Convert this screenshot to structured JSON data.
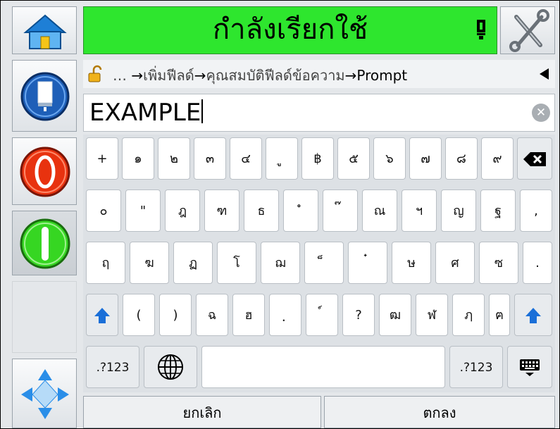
{
  "status": {
    "text": "กำลังเรียกใช้",
    "color": "#2ee62e"
  },
  "breadcrumb": {
    "prefix": "…",
    "items": [
      "เพิ่มฟีลด์",
      "คุณสมบัติฟีลด์ข้อความ",
      "Prompt"
    ],
    "separator": "→"
  },
  "textfield": {
    "value": "EXAMPLE",
    "clear_symbol": "✕"
  },
  "sidebar": {
    "icons": [
      "home-icon",
      "ink-icon",
      "stop-icon",
      "start-icon",
      "navigate-icon"
    ]
  },
  "keyboard": {
    "row1": [
      "+",
      "๑",
      "๒",
      "๓",
      "๔",
      "ู",
      "฿",
      "๕",
      "๖",
      "๗",
      "๘",
      "๙"
    ],
    "row2": [
      "๐",
      "\"",
      "ฎ",
      "ฑ",
      "ธ",
      "ํ",
      "๊",
      "ณ",
      "ฯ",
      "ญ",
      "ฐ",
      ","
    ],
    "row3": [
      "ฤ",
      "ฆ",
      "ฏ",
      "โ",
      "ฌ",
      "็",
      "๋",
      "ษ",
      "ศ",
      "ซ",
      "."
    ],
    "row4": [
      "(",
      ")",
      "ฉ",
      "ฮ",
      "ฺ",
      "์",
      "?",
      "ฒ",
      "ฬ",
      "ฦ",
      "ฅ"
    ],
    "sym_label_left": ".?123",
    "sym_label_right": ".?123"
  },
  "bottom": {
    "cancel_label": "ยกเลิก",
    "ok_label": "ตกลง"
  }
}
